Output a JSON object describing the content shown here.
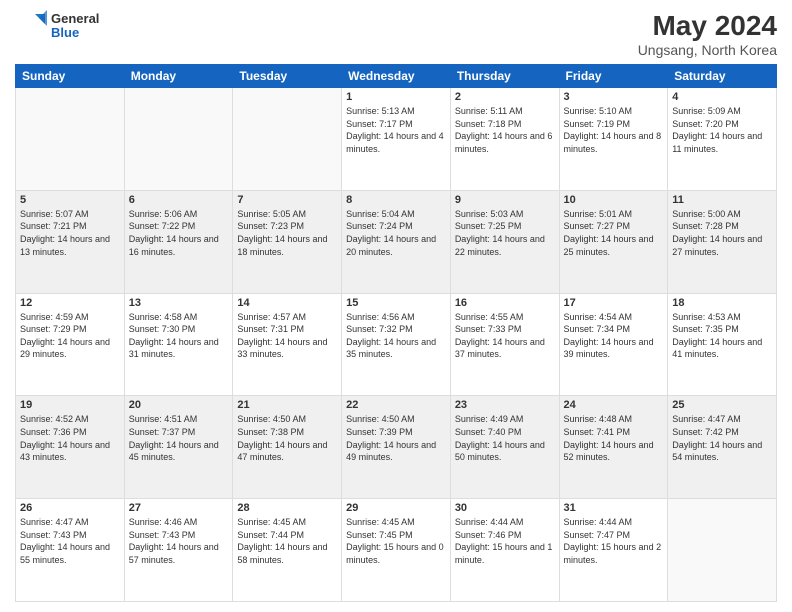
{
  "logo": {
    "general": "General",
    "blue": "Blue"
  },
  "title": "May 2024",
  "subtitle": "Ungsang, North Korea",
  "days_of_week": [
    "Sunday",
    "Monday",
    "Tuesday",
    "Wednesday",
    "Thursday",
    "Friday",
    "Saturday"
  ],
  "weeks": [
    {
      "alt": false,
      "days": [
        {
          "num": "",
          "empty": true
        },
        {
          "num": "",
          "empty": true
        },
        {
          "num": "",
          "empty": true
        },
        {
          "num": "1",
          "sunrise": "5:13 AM",
          "sunset": "7:17 PM",
          "daylight": "14 hours and 4 minutes."
        },
        {
          "num": "2",
          "sunrise": "5:11 AM",
          "sunset": "7:18 PM",
          "daylight": "14 hours and 6 minutes."
        },
        {
          "num": "3",
          "sunrise": "5:10 AM",
          "sunset": "7:19 PM",
          "daylight": "14 hours and 8 minutes."
        },
        {
          "num": "4",
          "sunrise": "5:09 AM",
          "sunset": "7:20 PM",
          "daylight": "14 hours and 11 minutes."
        }
      ]
    },
    {
      "alt": true,
      "days": [
        {
          "num": "5",
          "sunrise": "5:07 AM",
          "sunset": "7:21 PM",
          "daylight": "14 hours and 13 minutes."
        },
        {
          "num": "6",
          "sunrise": "5:06 AM",
          "sunset": "7:22 PM",
          "daylight": "14 hours and 16 minutes."
        },
        {
          "num": "7",
          "sunrise": "5:05 AM",
          "sunset": "7:23 PM",
          "daylight": "14 hours and 18 minutes."
        },
        {
          "num": "8",
          "sunrise": "5:04 AM",
          "sunset": "7:24 PM",
          "daylight": "14 hours and 20 minutes."
        },
        {
          "num": "9",
          "sunrise": "5:03 AM",
          "sunset": "7:25 PM",
          "daylight": "14 hours and 22 minutes."
        },
        {
          "num": "10",
          "sunrise": "5:01 AM",
          "sunset": "7:27 PM",
          "daylight": "14 hours and 25 minutes."
        },
        {
          "num": "11",
          "sunrise": "5:00 AM",
          "sunset": "7:28 PM",
          "daylight": "14 hours and 27 minutes."
        }
      ]
    },
    {
      "alt": false,
      "days": [
        {
          "num": "12",
          "sunrise": "4:59 AM",
          "sunset": "7:29 PM",
          "daylight": "14 hours and 29 minutes."
        },
        {
          "num": "13",
          "sunrise": "4:58 AM",
          "sunset": "7:30 PM",
          "daylight": "14 hours and 31 minutes."
        },
        {
          "num": "14",
          "sunrise": "4:57 AM",
          "sunset": "7:31 PM",
          "daylight": "14 hours and 33 minutes."
        },
        {
          "num": "15",
          "sunrise": "4:56 AM",
          "sunset": "7:32 PM",
          "daylight": "14 hours and 35 minutes."
        },
        {
          "num": "16",
          "sunrise": "4:55 AM",
          "sunset": "7:33 PM",
          "daylight": "14 hours and 37 minutes."
        },
        {
          "num": "17",
          "sunrise": "4:54 AM",
          "sunset": "7:34 PM",
          "daylight": "14 hours and 39 minutes."
        },
        {
          "num": "18",
          "sunrise": "4:53 AM",
          "sunset": "7:35 PM",
          "daylight": "14 hours and 41 minutes."
        }
      ]
    },
    {
      "alt": true,
      "days": [
        {
          "num": "19",
          "sunrise": "4:52 AM",
          "sunset": "7:36 PM",
          "daylight": "14 hours and 43 minutes."
        },
        {
          "num": "20",
          "sunrise": "4:51 AM",
          "sunset": "7:37 PM",
          "daylight": "14 hours and 45 minutes."
        },
        {
          "num": "21",
          "sunrise": "4:50 AM",
          "sunset": "7:38 PM",
          "daylight": "14 hours and 47 minutes."
        },
        {
          "num": "22",
          "sunrise": "4:50 AM",
          "sunset": "7:39 PM",
          "daylight": "14 hours and 49 minutes."
        },
        {
          "num": "23",
          "sunrise": "4:49 AM",
          "sunset": "7:40 PM",
          "daylight": "14 hours and 50 minutes."
        },
        {
          "num": "24",
          "sunrise": "4:48 AM",
          "sunset": "7:41 PM",
          "daylight": "14 hours and 52 minutes."
        },
        {
          "num": "25",
          "sunrise": "4:47 AM",
          "sunset": "7:42 PM",
          "daylight": "14 hours and 54 minutes."
        }
      ]
    },
    {
      "alt": false,
      "days": [
        {
          "num": "26",
          "sunrise": "4:47 AM",
          "sunset": "7:43 PM",
          "daylight": "14 hours and 55 minutes."
        },
        {
          "num": "27",
          "sunrise": "4:46 AM",
          "sunset": "7:43 PM",
          "daylight": "14 hours and 57 minutes."
        },
        {
          "num": "28",
          "sunrise": "4:45 AM",
          "sunset": "7:44 PM",
          "daylight": "14 hours and 58 minutes."
        },
        {
          "num": "29",
          "sunrise": "4:45 AM",
          "sunset": "7:45 PM",
          "daylight": "15 hours and 0 minutes."
        },
        {
          "num": "30",
          "sunrise": "4:44 AM",
          "sunset": "7:46 PM",
          "daylight": "15 hours and 1 minute."
        },
        {
          "num": "31",
          "sunrise": "4:44 AM",
          "sunset": "7:47 PM",
          "daylight": "15 hours and 2 minutes."
        },
        {
          "num": "",
          "empty": true
        }
      ]
    }
  ]
}
